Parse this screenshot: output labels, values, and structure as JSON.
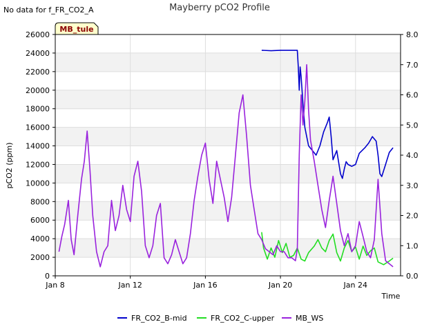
{
  "chart_data": {
    "type": "line",
    "title": "Mayberry pCO2 Profile",
    "note": "No data for f_FR_CO2_A",
    "badge": "MB_tule",
    "xlabel": "Time",
    "ylabel": "pCO2 (ppm)",
    "ylabel_right": "",
    "x_range_days": [
      0,
      18.4
    ],
    "x_ticks": [
      {
        "day": 0,
        "label": "Jan 8"
      },
      {
        "day": 4,
        "label": "Jan 12"
      },
      {
        "day": 8,
        "label": "Jan 16"
      },
      {
        "day": 12,
        "label": "Jan 20"
      },
      {
        "day": 16,
        "label": "Jan 24"
      }
    ],
    "ylim": [
      0,
      26000
    ],
    "y_ticks": [
      0,
      2000,
      4000,
      6000,
      8000,
      10000,
      12000,
      14000,
      16000,
      18000,
      20000,
      22000,
      24000,
      26000
    ],
    "ylim_right": [
      0,
      8.0
    ],
    "y_ticks_right": [
      "0.0",
      "1.0",
      "2.0",
      "3.0",
      "4.0",
      "5.0",
      "6.0",
      "7.0",
      "8.0"
    ],
    "grid": true,
    "series": [
      {
        "name": "FR_CO2_B-mid",
        "axis": "left",
        "color": "#0000cc",
        "points": [
          [
            11,
            24300
          ],
          [
            11.5,
            24250
          ],
          [
            12,
            24300
          ],
          [
            12.5,
            24300
          ],
          [
            12.9,
            24300
          ],
          [
            12.95,
            22500
          ],
          [
            13,
            20000
          ],
          [
            13.05,
            22500
          ],
          [
            13.1,
            21500
          ],
          [
            13.2,
            18500
          ],
          [
            13.3,
            16000
          ],
          [
            13.4,
            15000
          ],
          [
            13.5,
            14000
          ],
          [
            13.7,
            13500
          ],
          [
            13.9,
            13000
          ],
          [
            14.1,
            14000
          ],
          [
            14.3,
            15500
          ],
          [
            14.5,
            16500
          ],
          [
            14.6,
            17100
          ],
          [
            14.7,
            15000
          ],
          [
            14.8,
            12500
          ],
          [
            15,
            13500
          ],
          [
            15.2,
            11000
          ],
          [
            15.3,
            10500
          ],
          [
            15.4,
            11500
          ],
          [
            15.5,
            12300
          ],
          [
            15.6,
            12000
          ],
          [
            15.8,
            11800
          ],
          [
            16,
            12000
          ],
          [
            16.2,
            13200
          ],
          [
            16.5,
            13800
          ],
          [
            16.7,
            14300
          ],
          [
            16.9,
            15000
          ],
          [
            17.1,
            14500
          ],
          [
            17.2,
            13000
          ],
          [
            17.3,
            11000
          ],
          [
            17.4,
            10700
          ],
          [
            17.6,
            12000
          ],
          [
            17.8,
            13300
          ],
          [
            18,
            13800
          ]
        ]
      },
      {
        "name": "FR_CO2_C-upper",
        "axis": "left",
        "color": "#22dd22",
        "points": [
          [
            11,
            4700
          ],
          [
            11.1,
            3000
          ],
          [
            11.3,
            1800
          ],
          [
            11.5,
            3000
          ],
          [
            11.7,
            2000
          ],
          [
            11.9,
            3800
          ],
          [
            12.1,
            2500
          ],
          [
            12.3,
            3500
          ],
          [
            12.5,
            2000
          ],
          [
            12.7,
            2200
          ],
          [
            12.9,
            3000
          ],
          [
            13.1,
            1800
          ],
          [
            13.3,
            1600
          ],
          [
            13.5,
            2500
          ],
          [
            13.8,
            3200
          ],
          [
            14,
            3900
          ],
          [
            14.2,
            3000
          ],
          [
            14.4,
            2600
          ],
          [
            14.6,
            3800
          ],
          [
            14.8,
            4500
          ],
          [
            15,
            2500
          ],
          [
            15.2,
            1600
          ],
          [
            15.4,
            3000
          ],
          [
            15.6,
            3800
          ],
          [
            15.8,
            2600
          ],
          [
            16,
            3100
          ],
          [
            16.2,
            1800
          ],
          [
            16.4,
            3200
          ],
          [
            16.6,
            2200
          ],
          [
            16.8,
            2700
          ],
          [
            17,
            3000
          ],
          [
            17.2,
            1500
          ],
          [
            17.5,
            1200
          ],
          [
            17.8,
            1600
          ],
          [
            18,
            1900
          ]
        ]
      },
      {
        "name": "MB_WS",
        "axis": "right",
        "color": "#9922dd",
        "points": [
          [
            0.2,
            0.8
          ],
          [
            0.35,
            1.3
          ],
          [
            0.5,
            1.7
          ],
          [
            0.7,
            2.5
          ],
          [
            0.85,
            1.2
          ],
          [
            1,
            0.7
          ],
          [
            1.2,
            2.0
          ],
          [
            1.4,
            3.2
          ],
          [
            1.55,
            3.8
          ],
          [
            1.7,
            4.8
          ],
          [
            1.85,
            3.5
          ],
          [
            2,
            2.0
          ],
          [
            2.2,
            0.8
          ],
          [
            2.4,
            0.3
          ],
          [
            2.6,
            0.8
          ],
          [
            2.8,
            1.0
          ],
          [
            3,
            2.5
          ],
          [
            3.2,
            1.5
          ],
          [
            3.4,
            2.0
          ],
          [
            3.6,
            3.0
          ],
          [
            3.8,
            2.2
          ],
          [
            4,
            1.8
          ],
          [
            4.2,
            3.3
          ],
          [
            4.4,
            3.8
          ],
          [
            4.6,
            2.8
          ],
          [
            4.8,
            1.0
          ],
          [
            5,
            0.6
          ],
          [
            5.2,
            1.0
          ],
          [
            5.4,
            2.0
          ],
          [
            5.6,
            2.4
          ],
          [
            5.8,
            0.6
          ],
          [
            6,
            0.4
          ],
          [
            6.2,
            0.7
          ],
          [
            6.4,
            1.2
          ],
          [
            6.6,
            0.8
          ],
          [
            6.8,
            0.4
          ],
          [
            7,
            0.6
          ],
          [
            7.2,
            1.4
          ],
          [
            7.4,
            2.5
          ],
          [
            7.6,
            3.3
          ],
          [
            7.8,
            4.0
          ],
          [
            8,
            4.4
          ],
          [
            8.2,
            3.2
          ],
          [
            8.4,
            2.4
          ],
          [
            8.6,
            3.8
          ],
          [
            8.8,
            3.2
          ],
          [
            9,
            2.6
          ],
          [
            9.2,
            1.8
          ],
          [
            9.4,
            2.6
          ],
          [
            9.6,
            4.0
          ],
          [
            9.8,
            5.4
          ],
          [
            10,
            6.0
          ],
          [
            10.2,
            4.6
          ],
          [
            10.4,
            3.0
          ],
          [
            10.6,
            2.2
          ],
          [
            10.8,
            1.4
          ],
          [
            11,
            1.2
          ],
          [
            11.2,
            0.9
          ],
          [
            11.4,
            0.8
          ],
          [
            11.6,
            0.7
          ],
          [
            11.8,
            1.0
          ],
          [
            12,
            0.8
          ],
          [
            12.2,
            0.8
          ],
          [
            12.4,
            0.6
          ],
          [
            12.6,
            0.6
          ],
          [
            12.8,
            0.5
          ],
          [
            12.9,
            0.9
          ],
          [
            13,
            4.0
          ],
          [
            13.1,
            6.0
          ],
          [
            13.2,
            5.0
          ],
          [
            13.3,
            5.8
          ],
          [
            13.4,
            7.0
          ],
          [
            13.5,
            5.5
          ],
          [
            13.6,
            4.5
          ],
          [
            13.8,
            3.8
          ],
          [
            14,
            3.0
          ],
          [
            14.2,
            2.2
          ],
          [
            14.4,
            1.6
          ],
          [
            14.6,
            2.5
          ],
          [
            14.8,
            3.3
          ],
          [
            15,
            2.4
          ],
          [
            15.2,
            1.5
          ],
          [
            15.4,
            1.0
          ],
          [
            15.6,
            1.4
          ],
          [
            15.8,
            0.8
          ],
          [
            16,
            1.0
          ],
          [
            16.2,
            1.8
          ],
          [
            16.4,
            1.3
          ],
          [
            16.6,
            0.8
          ],
          [
            16.8,
            0.6
          ],
          [
            17,
            1.2
          ],
          [
            17.2,
            3.2
          ],
          [
            17.4,
            1.4
          ],
          [
            17.6,
            0.5
          ],
          [
            17.8,
            0.4
          ],
          [
            18,
            0.3
          ]
        ]
      }
    ],
    "legend_placement": "bottom"
  }
}
